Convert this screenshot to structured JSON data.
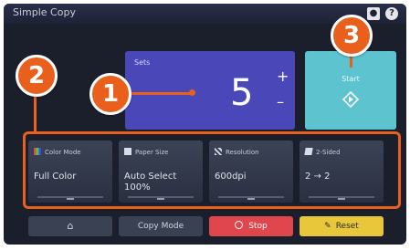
{
  "header": {
    "title": "Simple Copy"
  },
  "copies": {
    "label": "Sets",
    "value": "5",
    "plus": "+",
    "minus": "–"
  },
  "start": {
    "label": "Start"
  },
  "settings": [
    {
      "label": "Color Mode",
      "value": "Full Color"
    },
    {
      "label": "Paper Size",
      "value": "Auto Select\n100%"
    },
    {
      "label": "Resolution",
      "value": "600dpi"
    },
    {
      "label": "2-Sided",
      "value": "2 → 2"
    }
  ],
  "bottom": {
    "home_label": "⌂",
    "copy_mode_label": "Copy Mode",
    "stop_label": "Stop",
    "reset_label": "Reset"
  },
  "callouts": [
    "1",
    "2",
    "3"
  ],
  "colors": {
    "accent": "#e8601c",
    "copies": "#4a48b8",
    "start": "#5cc3cf",
    "stop": "#e0474c",
    "reset": "#e8c83a"
  }
}
